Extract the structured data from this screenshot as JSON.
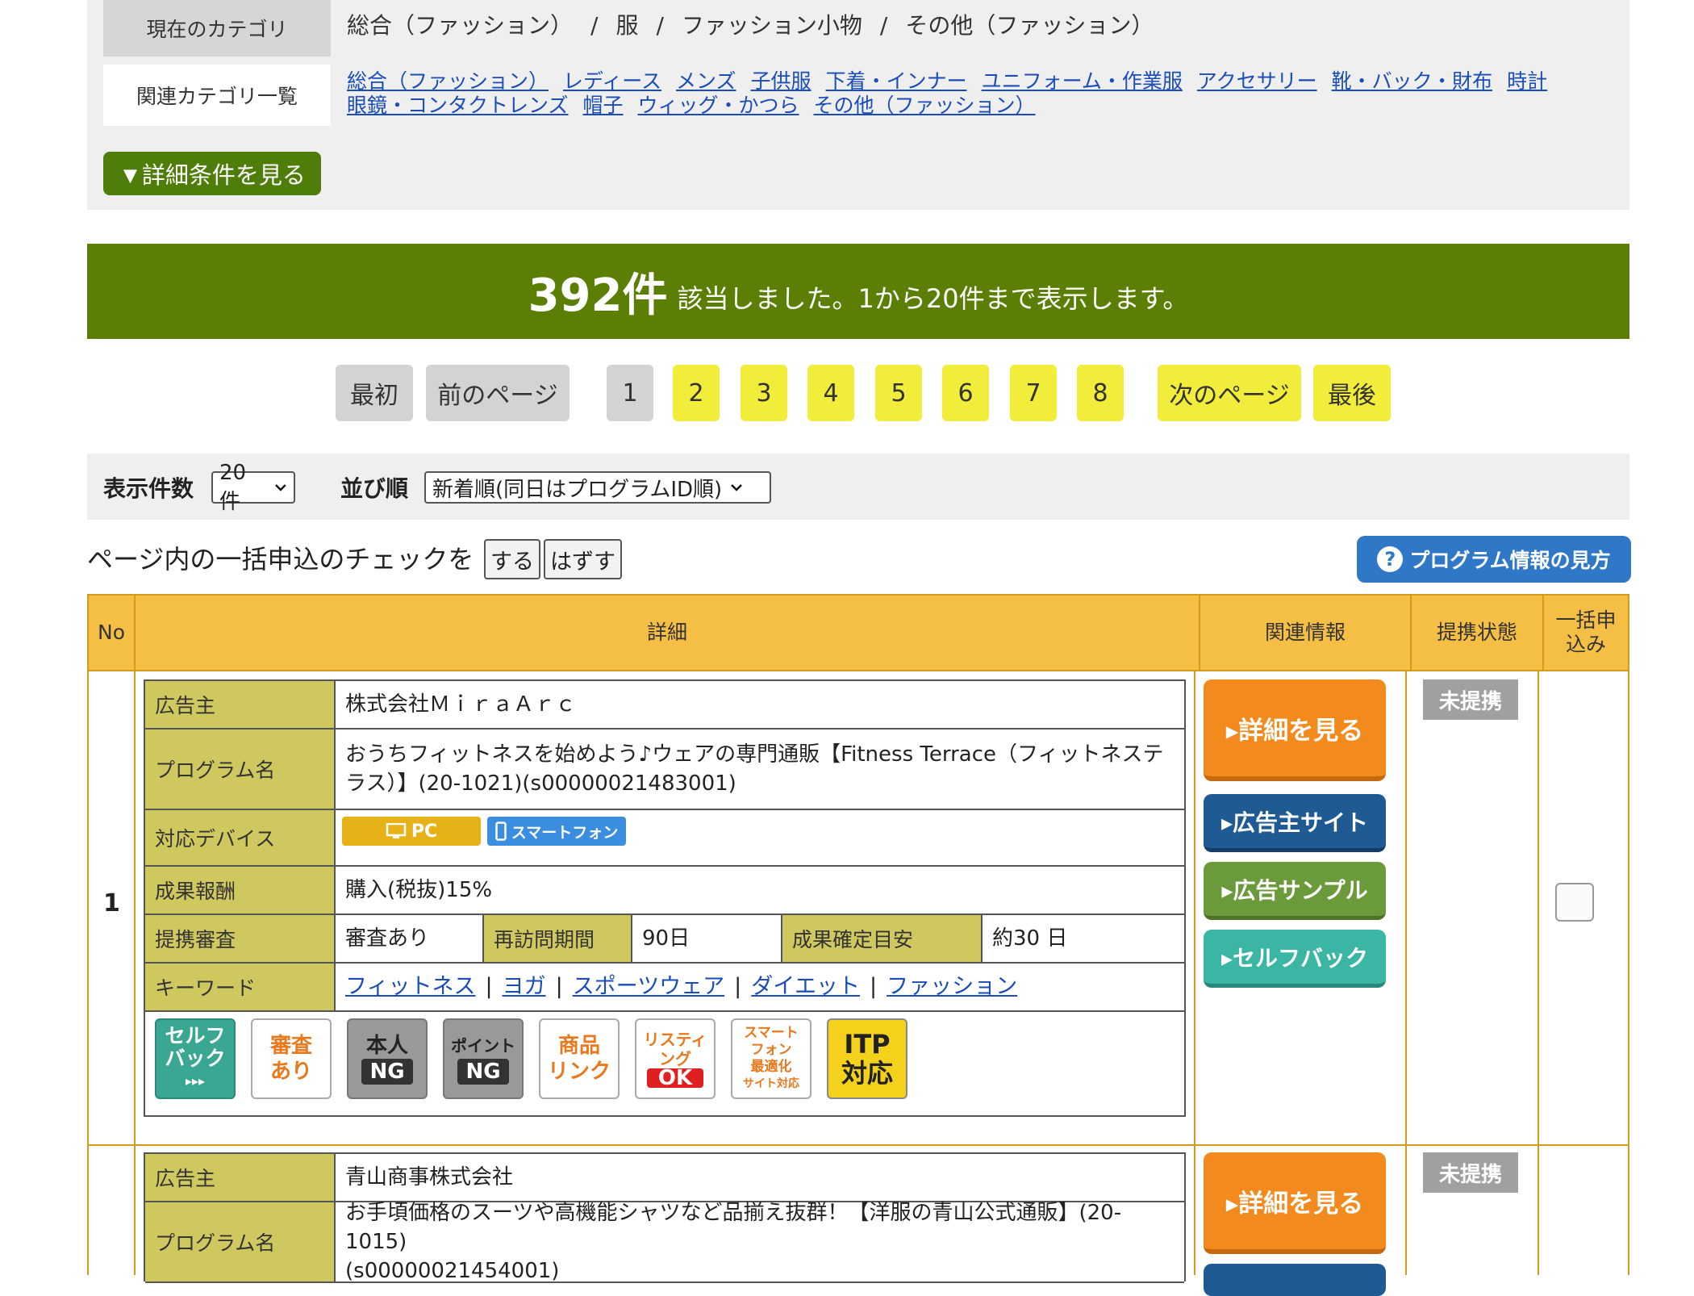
{
  "category": {
    "current_label": "現在のカテゴリ",
    "breadcrumb": [
      "総合（ファッション）",
      "服",
      "ファッション小物",
      "その他（ファッション）"
    ],
    "breadcrumb_sep": "/",
    "related_label": "関連カテゴリ一覧",
    "related_links": [
      "総合（ファッション）",
      "レディース",
      "メンズ",
      "子供服",
      "下着・インナー",
      "ユニフォーム・作業服",
      "アクセサリー",
      "靴・バック・財布",
      "時計",
      "眼鏡・コンタクトレンズ",
      "帽子",
      "ウィッグ・かつら",
      "その他（ファッション）"
    ],
    "detail_toggle": "▼詳細条件を見る"
  },
  "result": {
    "count": "392件",
    "text": "該当しました。1から20件まで表示します。"
  },
  "pagination": {
    "first": "最初",
    "prev": "前のページ",
    "pages": [
      "1",
      "2",
      "3",
      "4",
      "5",
      "6",
      "7",
      "8"
    ],
    "next": "次のページ",
    "last": "最後"
  },
  "display": {
    "count_label": "表示件数",
    "count_value": "20件",
    "sort_label": "並び順",
    "sort_value": "新着順(同日はプログラムID順)"
  },
  "bulk": {
    "label": "ページ内の一括申込のチェックを",
    "check_btn": "する",
    "uncheck_btn": "はずす",
    "help_btn": "プログラム情報の見方",
    "help_icon": "?"
  },
  "table_headers": {
    "no": "No",
    "detail": "詳細",
    "related": "関連情報",
    "status": "提携状態",
    "bulk_l1": "一括申",
    "bulk_l2": "込み"
  },
  "rows": [
    {
      "no": "1",
      "advertiser_label": "広告主",
      "advertiser": "株式会社ＭｉｒａＡｒｃ",
      "program_label": "プログラム名",
      "program_l1": "おうちフィットネスを始めよう♪ウェアの専門通販【Fitness Terrace（フィットネステ",
      "program_l2": "ラス）】(20-1021)(s00000021483001)",
      "device_label": "対応デバイス",
      "devices": [
        "PC",
        "スマートフォン"
      ],
      "reward_label": "成果報酬",
      "reward": "購入(税抜)15%",
      "review_label": "提携審査",
      "review": "審査あり",
      "revisit_label": "再訪問期間",
      "revisit": "90日",
      "confirm_label": "成果確定目安",
      "confirm": "約30 日",
      "keyword_label": "キーワード",
      "keywords": [
        "フィットネス",
        "ヨガ",
        "スポーツウェア",
        "ダイエット",
        "ファッション"
      ],
      "badges": [
        {
          "l1": "セルフ",
          "l2": "バック",
          "l3": "▸▸▸"
        },
        {
          "l1": "審査",
          "l2": "あり"
        },
        {
          "l1": "本人",
          "l2": "NG"
        },
        {
          "l1": "ポイント",
          "l2": "NG"
        },
        {
          "l1": "商品",
          "l2": "リンク"
        },
        {
          "l1": "リスティ",
          "l2": "ング",
          "l3": "OK"
        },
        {
          "l1": "スマート",
          "l2": "フォン",
          "l3": "最適化",
          "l4": "サイト対応"
        },
        {
          "l1": "ITP",
          "l2": "対応"
        }
      ],
      "btn_detail": "▸詳細を見る",
      "btn_site": "▸広告主サイト",
      "btn_sample": "▸広告サンプル",
      "btn_selfback": "▸セルフバック",
      "status": "未提携"
    },
    {
      "advertiser_label": "広告主",
      "advertiser": "青山商事株式会社",
      "program_label": "プログラム名",
      "program_l1": "お手頃価格のスーツや高機能シャツなど品揃え抜群！【洋服の青山公式通販】(20-1015)",
      "program_l2": "(s00000021454001)",
      "btn_detail": "▸詳細を見る",
      "status": "未提携"
    }
  ],
  "colors": {
    "green_banner": "#5b7f05",
    "header_orange": "#f5bf45",
    "label_olive": "#cfc85f",
    "btn_orange": "#f28a1e",
    "btn_blue": "#1f5a93",
    "btn_green": "#6b9a3a",
    "btn_teal": "#3bb5a4"
  }
}
